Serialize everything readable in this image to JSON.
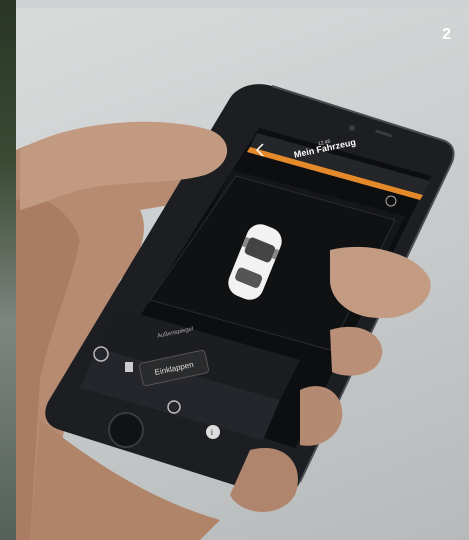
{
  "badge": "2",
  "app": {
    "title": "Mein Fahrzeug",
    "status_time": "12:45",
    "panel_label": "Außenspiegel",
    "action_button": "Einklappen"
  },
  "icons": [
    "back-arrow-icon",
    "battery-icon",
    "refresh-icon",
    "info-icon",
    "car-top-view-icon",
    "mirror-icon"
  ]
}
